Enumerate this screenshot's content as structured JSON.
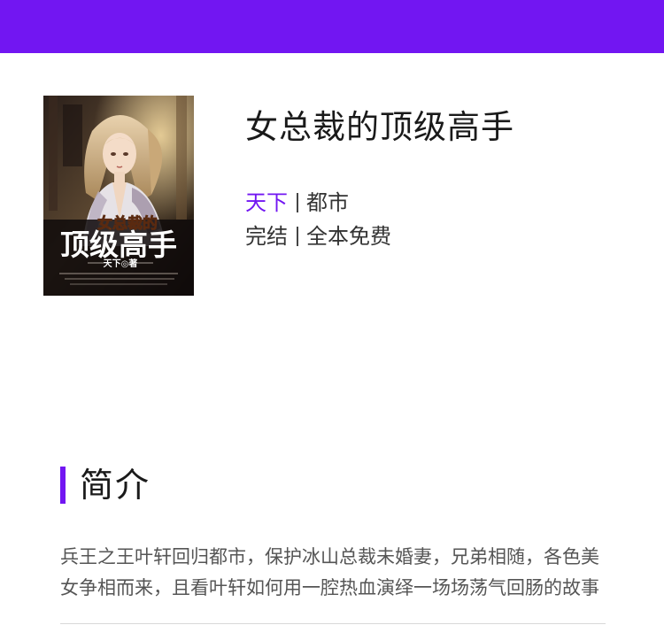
{
  "header": {
    "bar_color": "#7216f2"
  },
  "book": {
    "title": "女总裁的顶级高手",
    "author": "天下",
    "category": "都市",
    "status": "完结",
    "price_tag": "全本免费",
    "cover": {
      "title_small": "女总裁的",
      "title_large": "顶级高手",
      "author_credit": "天下◎著"
    }
  },
  "intro_section": {
    "heading": "简介",
    "text": "兵王之王叶轩回归都市，保护冰山总裁未婚妻，兄弟相随，各色美女争相而来，且看叶轩如何用一腔热血演绎一场场荡气回肠的故事"
  },
  "colors": {
    "accent": "#7216f2",
    "text": "#1a1a1a",
    "muted": "#555555"
  }
}
